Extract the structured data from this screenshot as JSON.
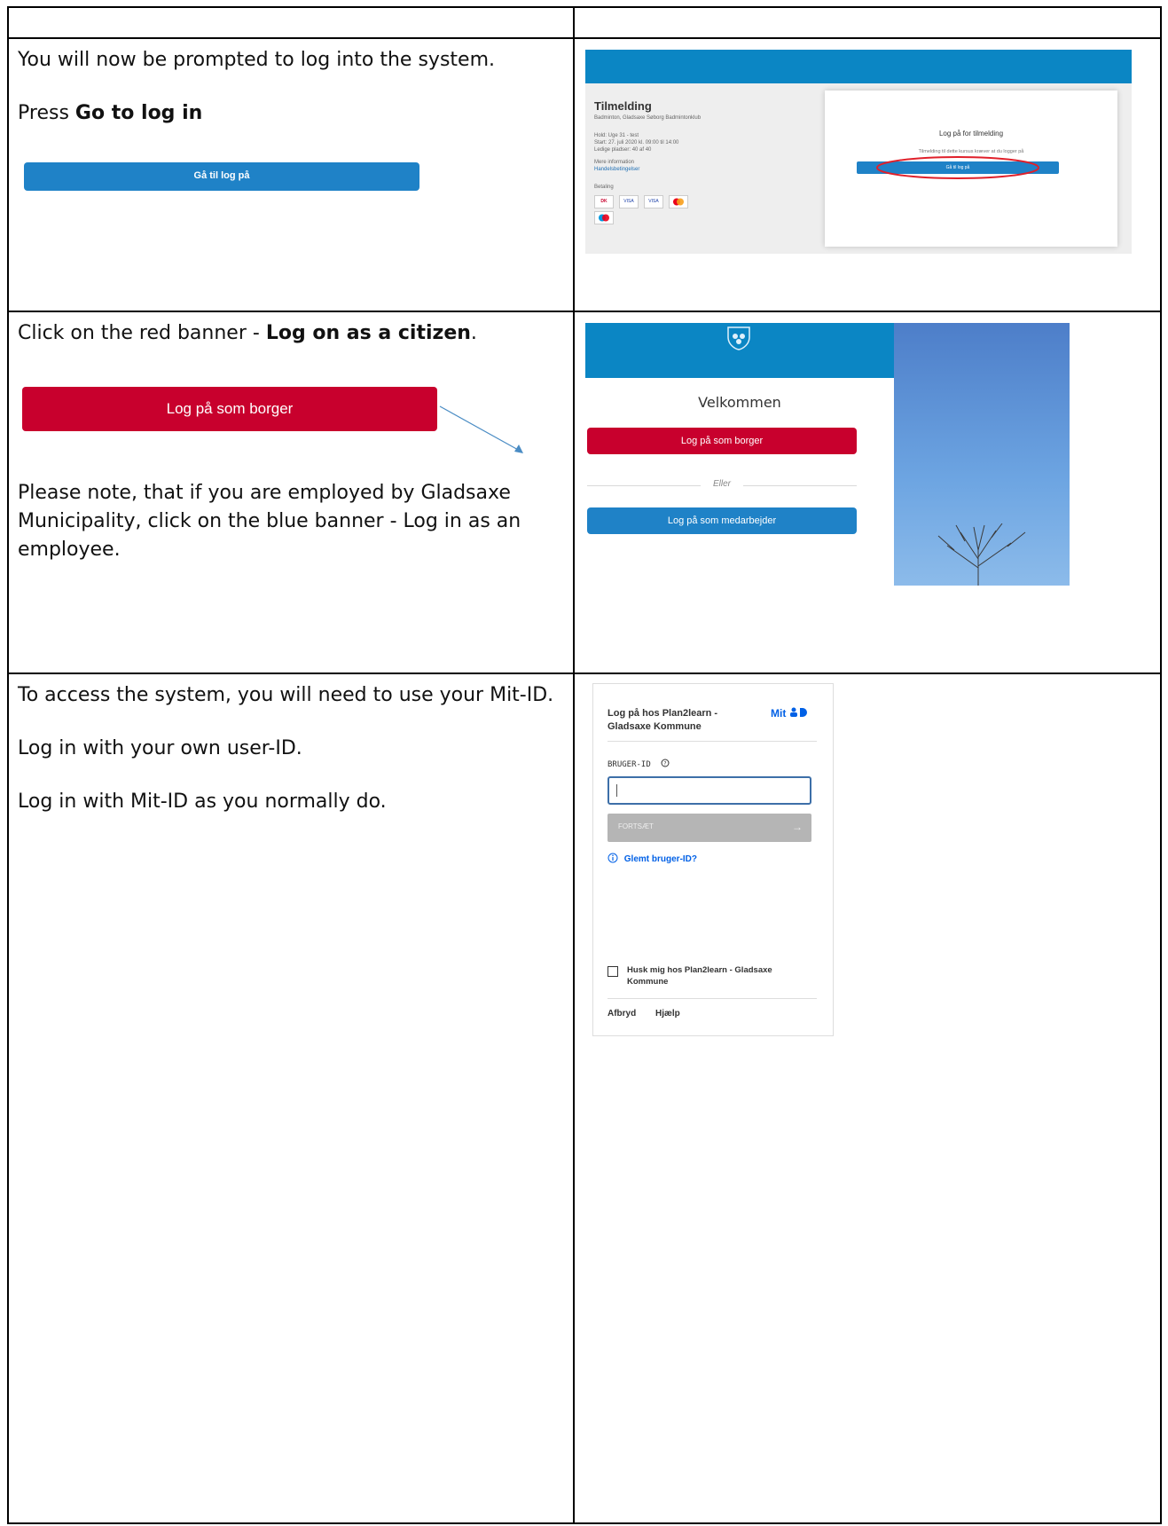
{
  "step1": {
    "line1": "You will now be prompted to log into the system.",
    "press_prefix": "Press ",
    "press_bold": "Go to log in",
    "button_label": "Gå til log på",
    "shot": {
      "title": "Tilmelding",
      "subtitle": "Badminton, Gladsaxe Søborg Badmintonklub",
      "hold": "Hold: Uge 31 - test",
      "start": "Start: 27. juli 2020 kl. 09:00 til 14:00",
      "ledige": "Ledige pladser: 40 af 40",
      "mere": "Mere information",
      "handels": "Handelsbetingelser",
      "betaling": "Betaling",
      "card_title": "Log på for tilmelding",
      "card_text": "Tilmelding til dette kursus kræver at du logger på",
      "card_button": "Gå til log på",
      "pay_dk": "DK",
      "pay_visa1": "VISA",
      "pay_visa2": "VISA"
    }
  },
  "step2": {
    "line1_prefix": "Click on the red banner - ",
    "line1_bold": "Log on as a citizen",
    "line1_suffix": ".",
    "button_label": "Log på som borger",
    "note": "Please note, that if you are employed by Gladsaxe Municipality, click on the blue banner - Log in as an employee.",
    "shot": {
      "welcome": "Velkommen",
      "citizen_btn": "Log på som borger",
      "or": "Eller",
      "employee_btn": "Log på som medarbejder"
    }
  },
  "step3": {
    "line1": "To access the system, you will need to use your Mit-ID.",
    "line2": "Log in with your own user-ID.",
    "line3": "Log in with Mit-ID as you normally do.",
    "shot": {
      "title": "Log på hos Plan2learn - Gladsaxe Kommune",
      "logo": "Mit",
      "userid_label": "BRUGER-ID",
      "continue": "FORTSÆT",
      "forgot": "Glemt bruger-ID?",
      "remember": "Husk mig hos Plan2learn - Gladsaxe Kommune",
      "cancel": "Afbryd",
      "help": "Hjælp"
    }
  },
  "colors": {
    "red": "#c8002d",
    "blue": "#1f82c7",
    "header_blue": "#0b86c4"
  }
}
